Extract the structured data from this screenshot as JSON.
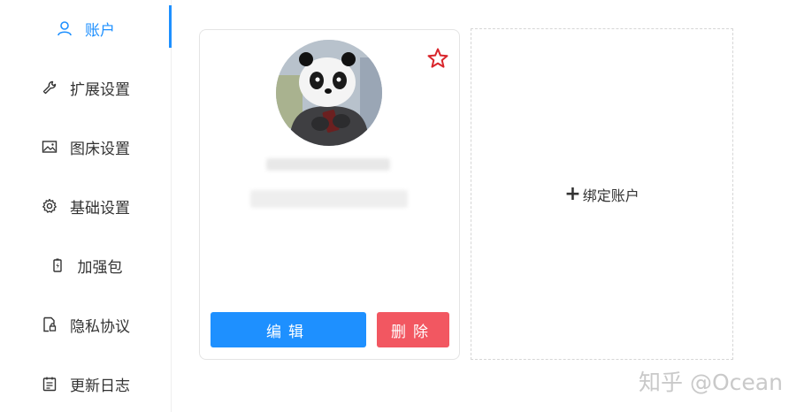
{
  "sidebar": {
    "items": [
      {
        "label": "账户",
        "icon": "user-icon"
      },
      {
        "label": "扩展设置",
        "icon": "wrench-icon"
      },
      {
        "label": "图床设置",
        "icon": "image-icon"
      },
      {
        "label": "基础设置",
        "icon": "gear-icon"
      },
      {
        "label": "加强包",
        "icon": "battery-icon"
      },
      {
        "label": "隐私协议",
        "icon": "document-lock-icon"
      },
      {
        "label": "更新日志",
        "icon": "calendar-icon"
      }
    ],
    "active_index": 0
  },
  "account_card": {
    "favorite_icon": "star-icon",
    "edit_label": "编辑",
    "delete_label": "删除"
  },
  "bind_card": {
    "plus": "+",
    "label": "绑定账户"
  },
  "watermark": {
    "text": "知乎 @Ocean"
  },
  "colors": {
    "accent": "#1e90ff",
    "danger": "#f25761",
    "star": "#d9262c"
  }
}
